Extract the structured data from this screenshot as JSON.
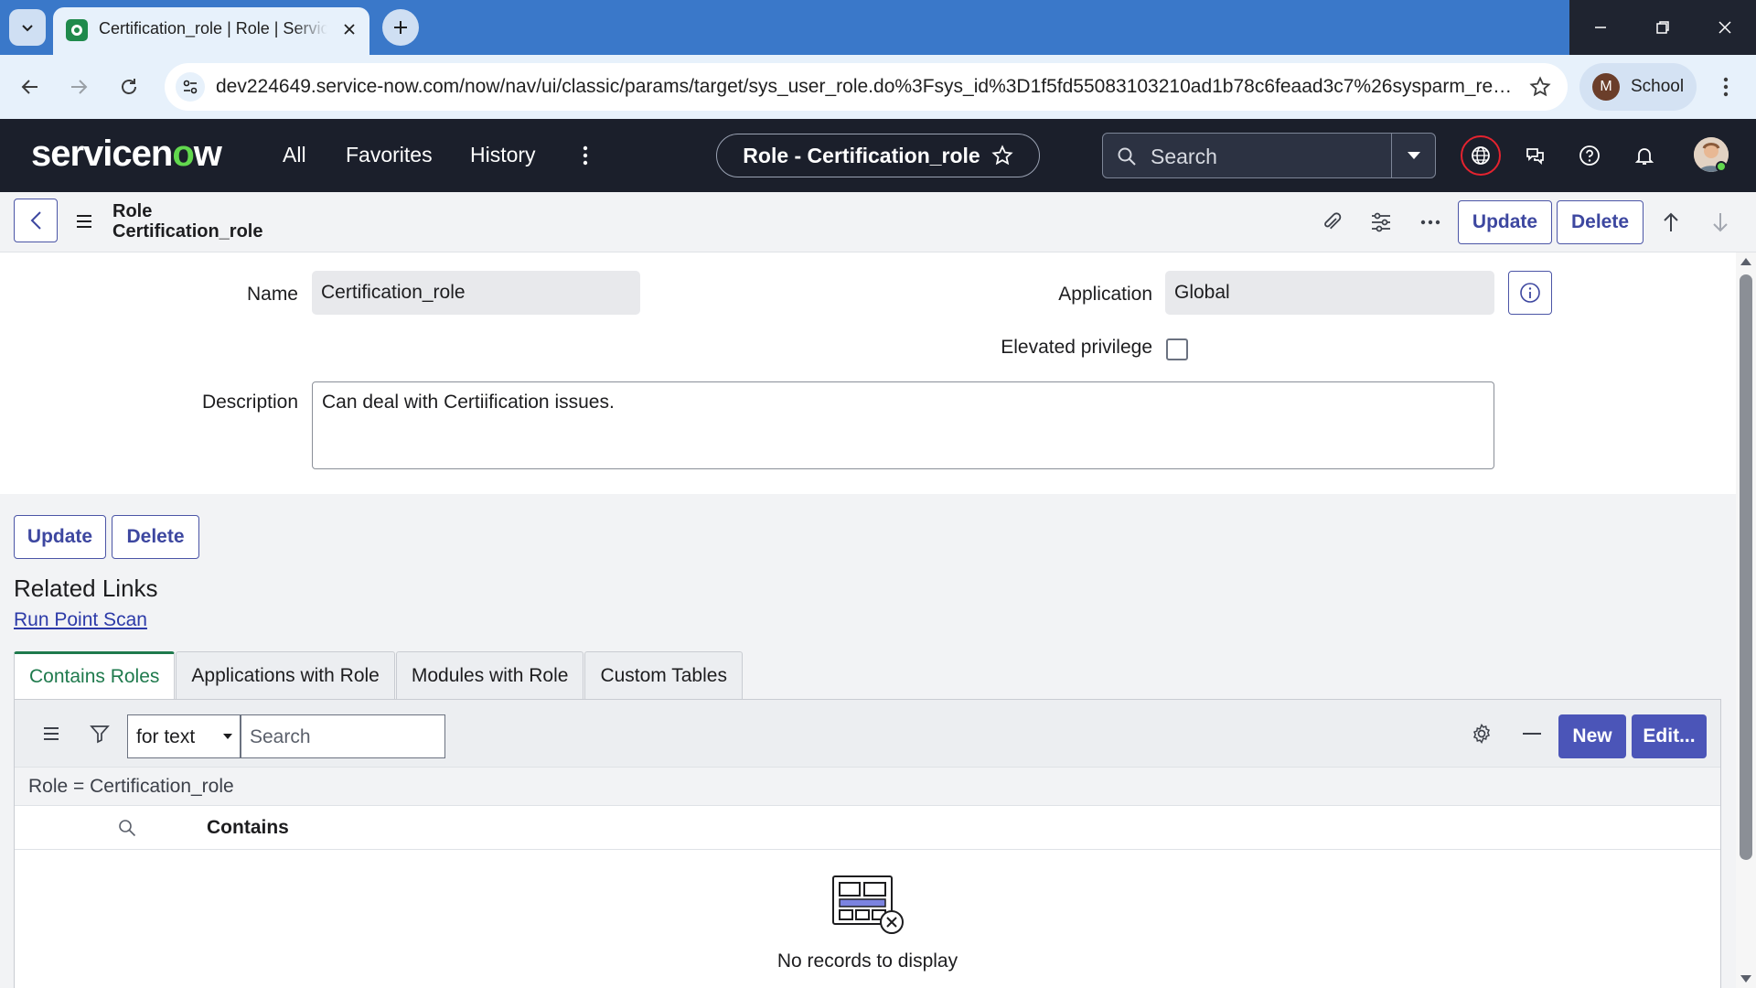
{
  "browser": {
    "tab_title": "Certification_role | Role | ServiceNow",
    "url": "dev224649.service-now.com/now/nav/ui/classic/params/target/sys_user_role.do%3Fsys_id%3D1f5fd55083103210ad1b78c6feaad3c7%26sysparm_recor...",
    "profile_initial": "M",
    "profile_name": "School"
  },
  "header": {
    "logo_parts": [
      "servicen",
      "o",
      "w"
    ],
    "nav": [
      "All",
      "Favorites",
      "History"
    ],
    "context_title": "Role - Certification_role",
    "search_placeholder": "Search"
  },
  "form": {
    "header_table": "Role",
    "header_record": "Certification_role",
    "update_label": "Update",
    "delete_label": "Delete",
    "fields": {
      "name_label": "Name",
      "name_value": "Certification_role",
      "application_label": "Application",
      "application_value": "Global",
      "elevated_label": "Elevated privilege",
      "elevated_checked": false,
      "description_label": "Description",
      "description_value": "Can deal with Certiification issues."
    }
  },
  "related": {
    "title": "Related Links",
    "link": "Run Point Scan",
    "tabs": [
      "Contains Roles",
      "Applications with Role",
      "Modules with Role",
      "Custom Tables"
    ],
    "active_tab": 0
  },
  "list": {
    "search_field": "for text",
    "search_placeholder": "Search",
    "new_label": "New",
    "edit_label": "Edit...",
    "breadcrumb": "Role = Certification_role",
    "column": "Contains",
    "empty_text": "No records to display"
  },
  "colors": {
    "accent": "#4b55b8",
    "header_bg": "#1b1f2b",
    "browser_tabstrip": "#3a78c9",
    "active_tab": "#1f7a4d"
  }
}
